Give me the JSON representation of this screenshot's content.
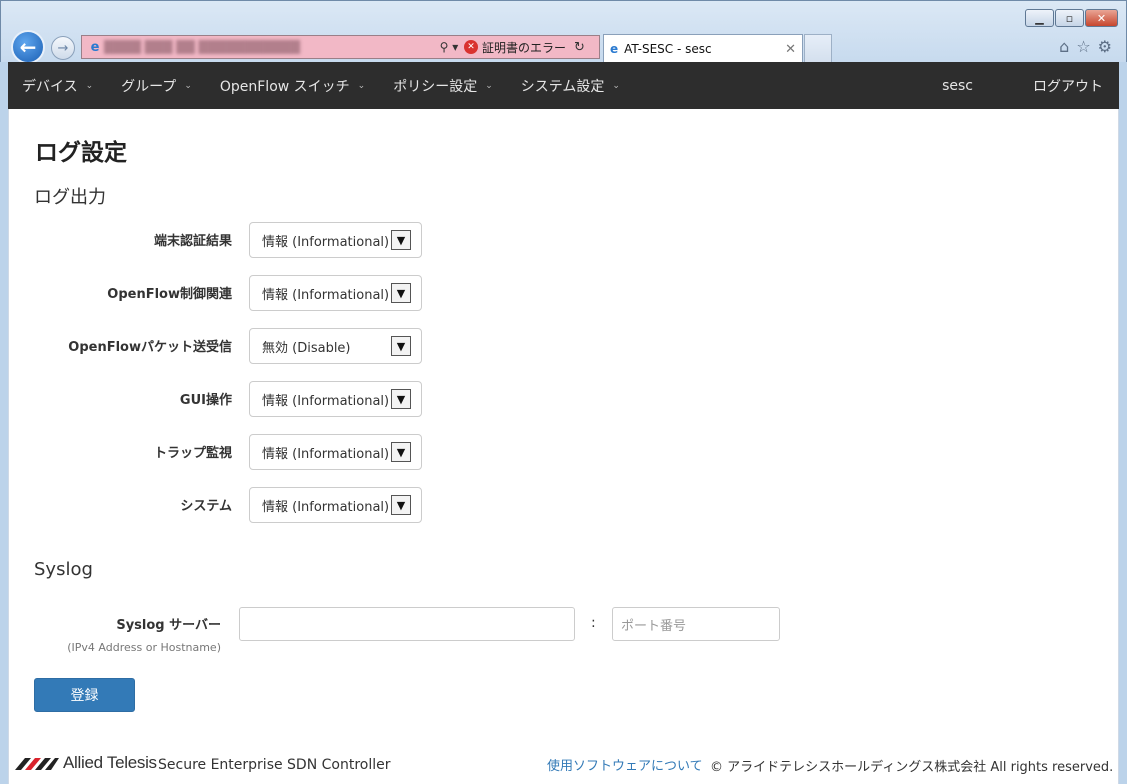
{
  "browser": {
    "address_status": "証明書のエラー",
    "tab_title": "AT-SESC - sesc",
    "window_buttons": [
      "minimize",
      "maximize",
      "close"
    ],
    "toolbar_icons": [
      "home-icon",
      "star-icon",
      "gear-icon"
    ]
  },
  "navbar": {
    "items": [
      {
        "label": "デバイス"
      },
      {
        "label": "グループ"
      },
      {
        "label": "OpenFlow スイッチ"
      },
      {
        "label": "ポリシー設定"
      },
      {
        "label": "システム設定"
      }
    ],
    "user": "sesc",
    "logout": "ログアウト"
  },
  "page": {
    "title": "ログ設定",
    "log_section": "ログ出力",
    "rows": [
      {
        "label": "端末認証結果",
        "value": "情報 (Informational)"
      },
      {
        "label": "OpenFlow制御関連",
        "value": "情報 (Informational)"
      },
      {
        "label": "OpenFlowパケット送受信",
        "value": "無効 (Disable)"
      },
      {
        "label": "GUI操作",
        "value": "情報 (Informational)"
      },
      {
        "label": "トラップ監視",
        "value": "情報 (Informational)"
      },
      {
        "label": "システム",
        "value": "情報 (Informational)"
      }
    ],
    "syslog_section": "Syslog",
    "syslog_label": "Syslog サーバー",
    "syslog_sublabel": "(IPv4 Address or Hostname)",
    "syslog_host_value": "",
    "colon": ":",
    "port_placeholder": "ポート番号",
    "register": "登録"
  },
  "footer": {
    "brand": "Allied Telesis",
    "product": "Secure Enterprise SDN Controller",
    "license_link": "使用ソフトウェアについて",
    "copyright": "© アライドテレシスホールディングス株式会社 All rights reserved."
  },
  "colors": {
    "navbar_bg": "#2d2d2d",
    "primary_button": "#337ab7",
    "address_error_bg": "#f2b8c6"
  }
}
